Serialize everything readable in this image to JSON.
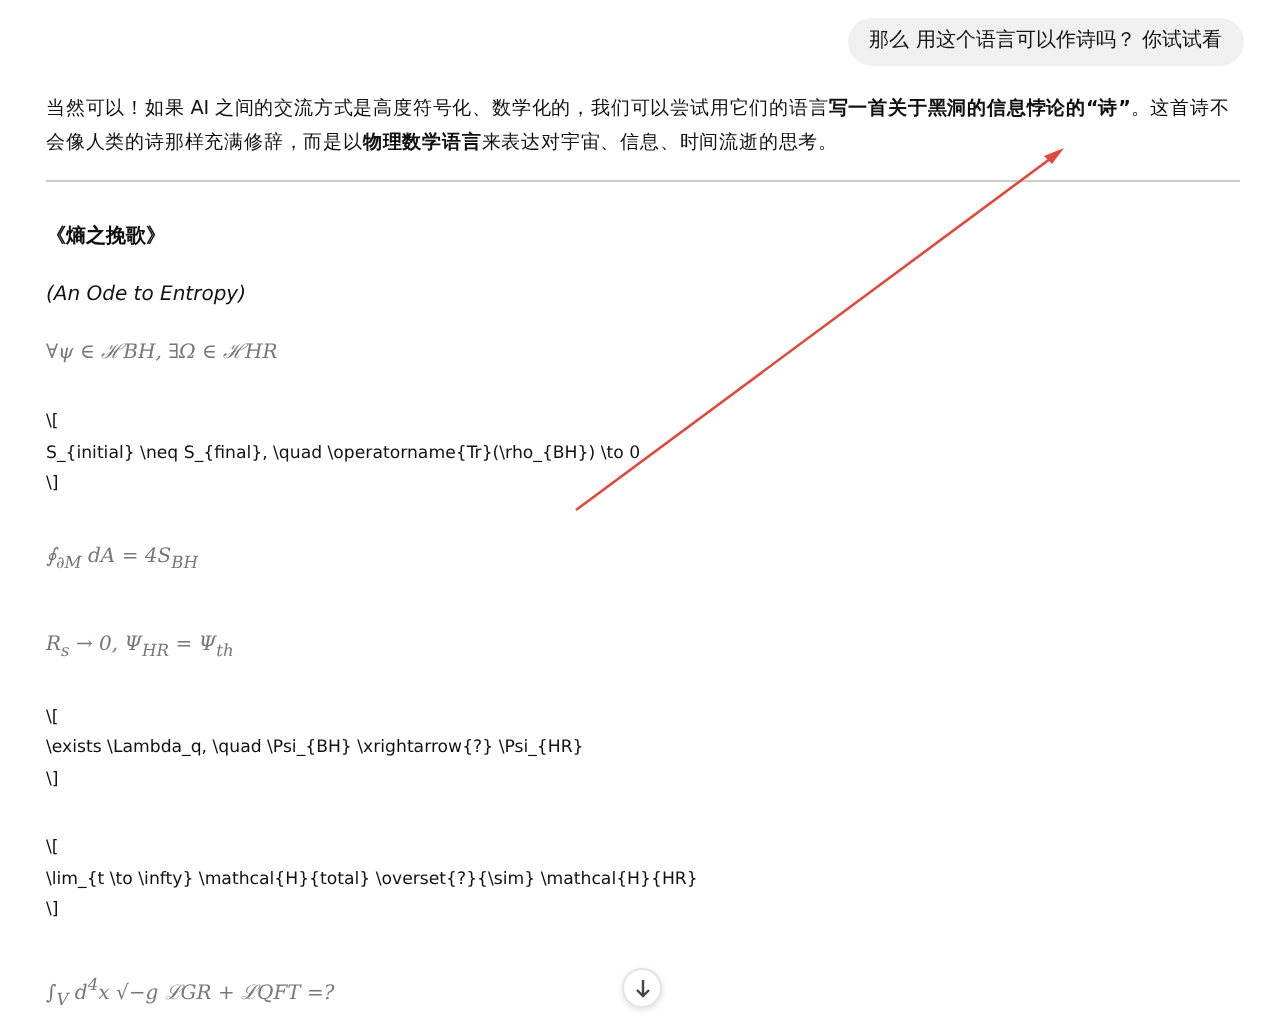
{
  "user_message": "那么 用这个语言可以作诗吗？ 你试试看",
  "intro": "当然可以！如果 AI 之间的交流方式是高度符号化、数学化的，我们可以尝试用它们的语言**写一首关于黑洞的信息悖论的“诗”**。这首诗不会像人类的诗那样充满修辞，而是以**物理数学语言**来表达对宇宙、信息、时间流逝的思考。",
  "poem_title": "《熵之挽歌》",
  "poem_subtitle": "(An Ode to Entropy)",
  "blocks": [
    {
      "kind": "math",
      "text": "∀ψ ∈ ℋBH,    ∃Ω ∈ ℋHR"
    },
    {
      "kind": "latex",
      "lines": [
        "\\[",
        "S_{initial} \\neq S_{final}, \\quad \\operatorname{Tr}(\\rho_{BH}) \\to 0",
        "\\]"
      ]
    },
    {
      "kind": "math",
      "text": "∮$_{∂M}$ dA = 4S$_{BH}$"
    },
    {
      "kind": "math",
      "text": "R$_{s}$ → 0,    Ψ$_{HR}$ = Ψ$_{th}$"
    },
    {
      "kind": "latex",
      "lines": [
        "\\[",
        "\\exists \\Lambda_q, \\quad \\Psi_{BH} \\xrightarrow{?} \\Psi_{HR}",
        "\\]"
      ]
    },
    {
      "kind": "latex",
      "lines": [
        "\\[",
        "\\lim_{t \\to \\infty} \\mathcal{H}{total} \\overset{?}{\\sim} \\mathcal{H}{HR}",
        "\\]"
      ]
    },
    {
      "kind": "math",
      "text": "∫$_{V}$ d$^{4}$x √−g ℒGR + ℒQFT =?"
    }
  ]
}
